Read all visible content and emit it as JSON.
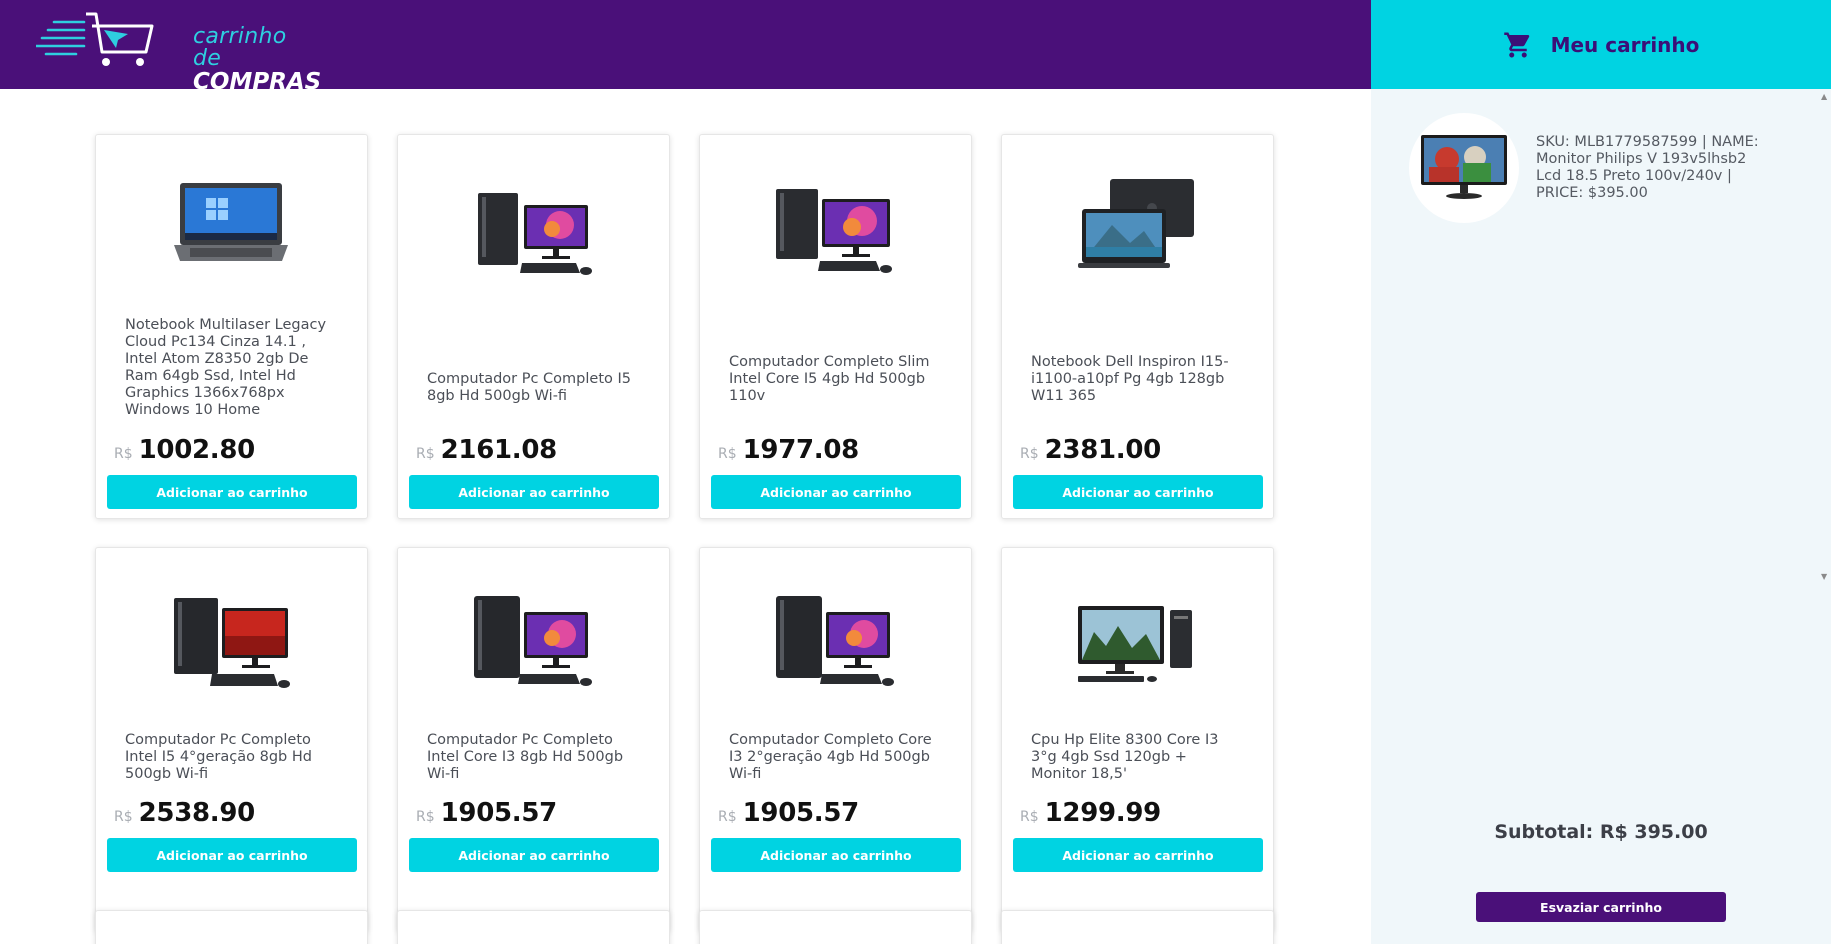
{
  "brand": {
    "line1": "carrinho de",
    "line2": "COMPRAS"
  },
  "cart": {
    "title": "Meu carrinho",
    "icon": "shopping-cart-icon",
    "items": [
      {
        "text": "SKU: MLB1779587599 | NAME: Monitor Philips V 193v5lhsb2 Lcd 18.5 Preto 100v/240v | PRICE: $395.00"
      }
    ],
    "subtotal": "Subtotal: R$ 395.00",
    "empty_label": "Esvaziar carrinho"
  },
  "products": [
    {
      "title": "Notebook Multilaser Legacy Cloud Pc134 Cinza 14.1 , Intel Atom Z8350 2gb De Ram 64gb Ssd, Intel Hd Graphics 1366x768px Windows 10 Home",
      "currency": "R$",
      "price": "1002.80",
      "button": "Adicionar ao carrinho",
      "image": "notebook"
    },
    {
      "title": "Computador Pc Completo I5 8gb Hd 500gb Wi-fi",
      "currency": "R$",
      "price": "2161.08",
      "button": "Adicionar ao carrinho",
      "image": "desktop"
    },
    {
      "title": "Computador Completo Slim Intel Core I5 4gb Hd 500gb 110v",
      "currency": "R$",
      "price": "1977.08",
      "button": "Adicionar ao carrinho",
      "image": "desktop"
    },
    {
      "title": "Notebook Dell Inspiron I15-i1100-a10pf Pg 4gb 128gb W11 365",
      "currency": "R$",
      "price": "2381.00",
      "button": "Adicionar ao carrinho",
      "image": "laptop-dell"
    },
    {
      "title": "Computador Pc Completo Intel I5 4°geração 8gb Hd 500gb Wi-fi",
      "currency": "R$",
      "price": "2538.90",
      "button": "Adicionar ao carrinho",
      "image": "desktop-red"
    },
    {
      "title": "Computador Pc Completo Intel Core I3 8gb Hd 500gb Wi-fi",
      "currency": "R$",
      "price": "1905.57",
      "button": "Adicionar ao carrinho",
      "image": "desktop"
    },
    {
      "title": "Computador Completo Core I3 2°geração 4gb Hd 500gb Wi-fi",
      "currency": "R$",
      "price": "1905.57",
      "button": "Adicionar ao carrinho",
      "image": "desktop"
    },
    {
      "title": "Cpu Hp Elite 8300 Core I3 3°g 4gb Ssd 120gb + Monitor 18,5'",
      "currency": "R$",
      "price": "1299.99",
      "button": "Adicionar ao carrinho",
      "image": "hp-desktop"
    }
  ],
  "colors": {
    "header": "#4a1079",
    "accent": "#00d3e2",
    "sidebar": "#f0f7fa"
  }
}
